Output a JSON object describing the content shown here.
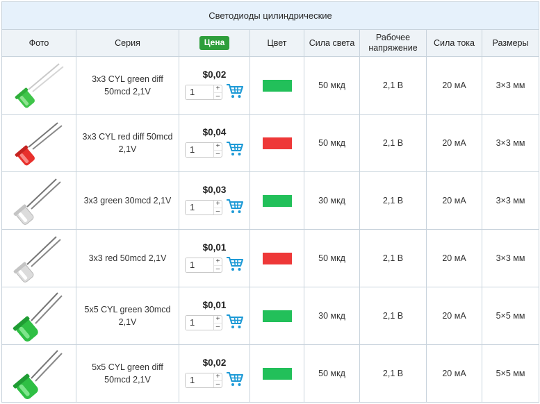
{
  "title": "Светодиоды цилиндрические",
  "headers": {
    "photo": "Фото",
    "series": "Серия",
    "price": "Цена",
    "color": "Цвет",
    "luminous": "Сила света",
    "voltage": "Рабочее напряжение",
    "current": "Сила тока",
    "size": "Размеры"
  },
  "colors": {
    "green": "#22c05a",
    "red": "#ee3838",
    "accent": "#2e9e3b",
    "cart": "#1e9ad6"
  },
  "rows": [
    {
      "name": "3x3 CYL green diff 50mcd 2,1V",
      "price": "$0,02",
      "qty": "1",
      "color": "green",
      "luminous": "50 мкд",
      "voltage": "2,1 В",
      "current": "20 мА",
      "size": "3×3 мм",
      "icon": "led-green-diffused-icon"
    },
    {
      "name": "3x3 CYL red diff 50mcd 2,1V",
      "price": "$0,04",
      "qty": "1",
      "color": "red",
      "luminous": "50 мкд",
      "voltage": "2,1 В",
      "current": "20 мА",
      "size": "3×3 мм",
      "icon": "led-red-diffused-icon"
    },
    {
      "name": "3x3 green 30mcd 2,1V",
      "price": "$0,03",
      "qty": "1",
      "color": "green",
      "luminous": "30 мкд",
      "voltage": "2,1 В",
      "current": "20 мА",
      "size": "3×3 мм",
      "icon": "led-clear-icon"
    },
    {
      "name": "3x3 red 50mcd 2,1V",
      "price": "$0,01",
      "qty": "1",
      "color": "red",
      "luminous": "50 мкд",
      "voltage": "2,1 В",
      "current": "20 мА",
      "size": "3×3 мм",
      "icon": "led-clear-icon"
    },
    {
      "name": "5x5 CYL green 30mcd 2,1V",
      "price": "$0,01",
      "qty": "1",
      "color": "green",
      "luminous": "30 мкд",
      "voltage": "2,1 В",
      "current": "20 мА",
      "size": "5×5 мм",
      "icon": "led-green-large-icon"
    },
    {
      "name": "5x5 CYL green diff 50mcd 2,1V",
      "price": "$0,02",
      "qty": "1",
      "color": "green",
      "luminous": "50 мкд",
      "voltage": "2,1 В",
      "current": "20 мА",
      "size": "5×5 мм",
      "icon": "led-green-large-icon"
    }
  ],
  "stepper": {
    "up": "+",
    "down": "–"
  }
}
